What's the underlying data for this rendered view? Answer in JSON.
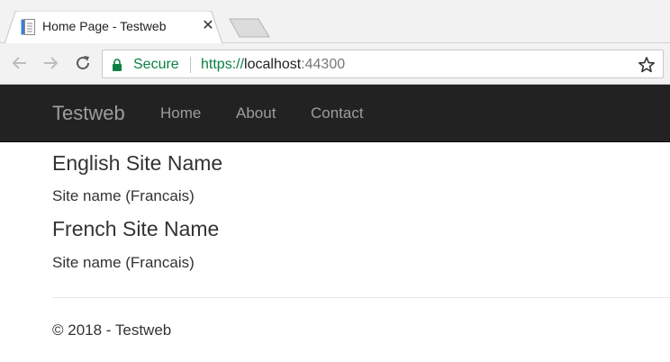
{
  "browser": {
    "tab_title": "Home Page - Testweb",
    "tab_close": "✕",
    "security_label": "Secure",
    "url_scheme": "https://",
    "url_host": "localhost",
    "url_port": ":44300",
    "accent_secure": "#0b8043"
  },
  "navbar": {
    "brand": "Testweb",
    "links": [
      {
        "label": "Home"
      },
      {
        "label": "About"
      },
      {
        "label": "Contact"
      }
    ],
    "background": "#222222",
    "link_color": "#9d9d9d"
  },
  "main": {
    "sections": [
      {
        "heading": "English Site Name",
        "value": "Site name (Francais)"
      },
      {
        "heading": "French Site Name",
        "value": "Site name (Francais)"
      }
    ]
  },
  "footer": {
    "text": "© 2018 - Testweb"
  }
}
